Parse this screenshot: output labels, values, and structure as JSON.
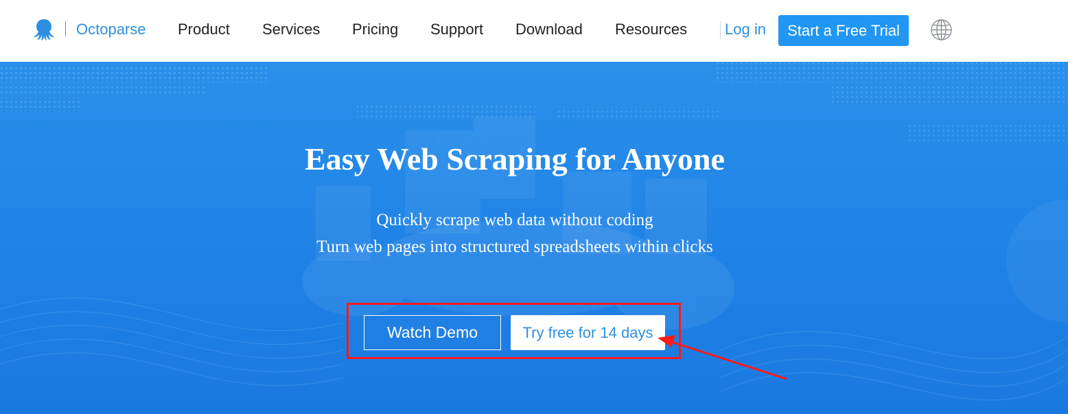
{
  "brand": {
    "name": "Octoparse",
    "logo_icon": "octopus-icon",
    "color": "#2d8fe0"
  },
  "nav": {
    "items": [
      {
        "label": "Product"
      },
      {
        "label": "Services"
      },
      {
        "label": "Pricing"
      },
      {
        "label": "Support"
      },
      {
        "label": "Download"
      },
      {
        "label": "Resources"
      }
    ],
    "login": "Log in",
    "trial_button": "Start a Free Trial",
    "language_icon": "globe-icon"
  },
  "hero": {
    "title": "Easy Web Scraping for Anyone",
    "subtitle_1": "Quickly scrape web data without coding",
    "subtitle_2": "Turn web pages into structured spreadsheets within clicks",
    "watch_demo": "Watch Demo",
    "try_free": "Try free for 14 days",
    "background_color": "#1f82e6",
    "annotation_color": "#ff1a1a"
  }
}
